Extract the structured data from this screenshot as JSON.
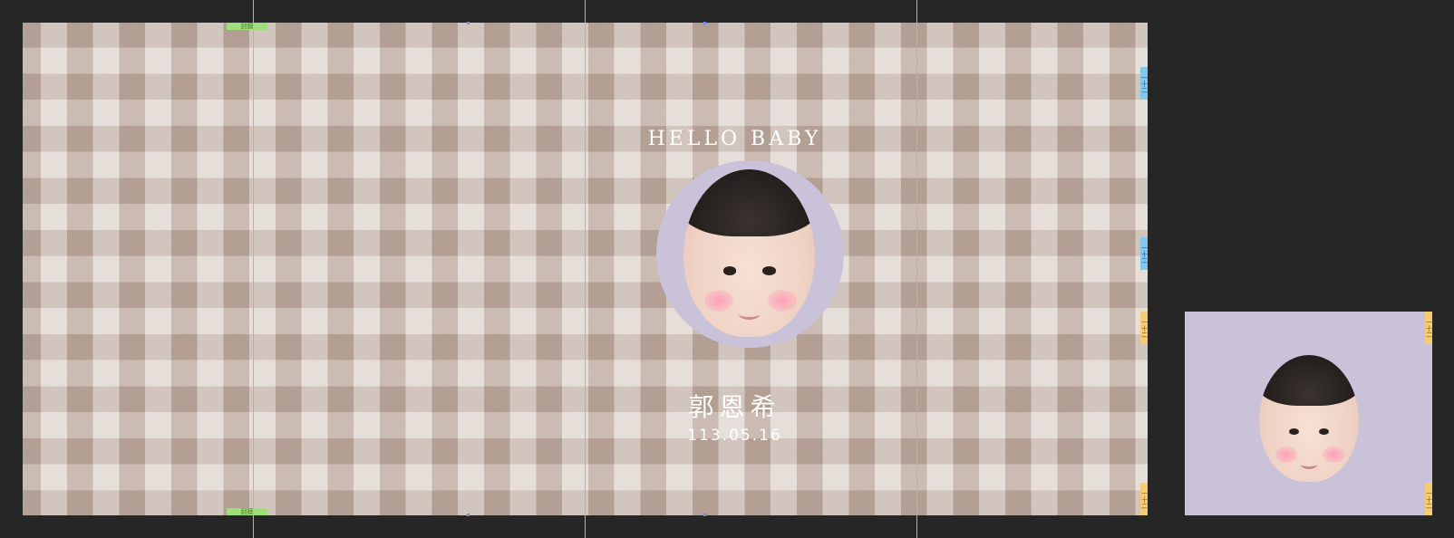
{
  "design": {
    "heading": "HELLO BABY",
    "baby_name": "郭恩希",
    "birth_date": "113.05.16"
  },
  "guide_tabs": {
    "green_label": "刮膜",
    "side_label": "一十二"
  },
  "colors": {
    "workspace": "#262626",
    "gingham": "#cbbcb2",
    "avatar_bg": "#c9c2d9",
    "guide": "#5ed6d8"
  },
  "icons": [
    "baby-face-photo-icon"
  ]
}
